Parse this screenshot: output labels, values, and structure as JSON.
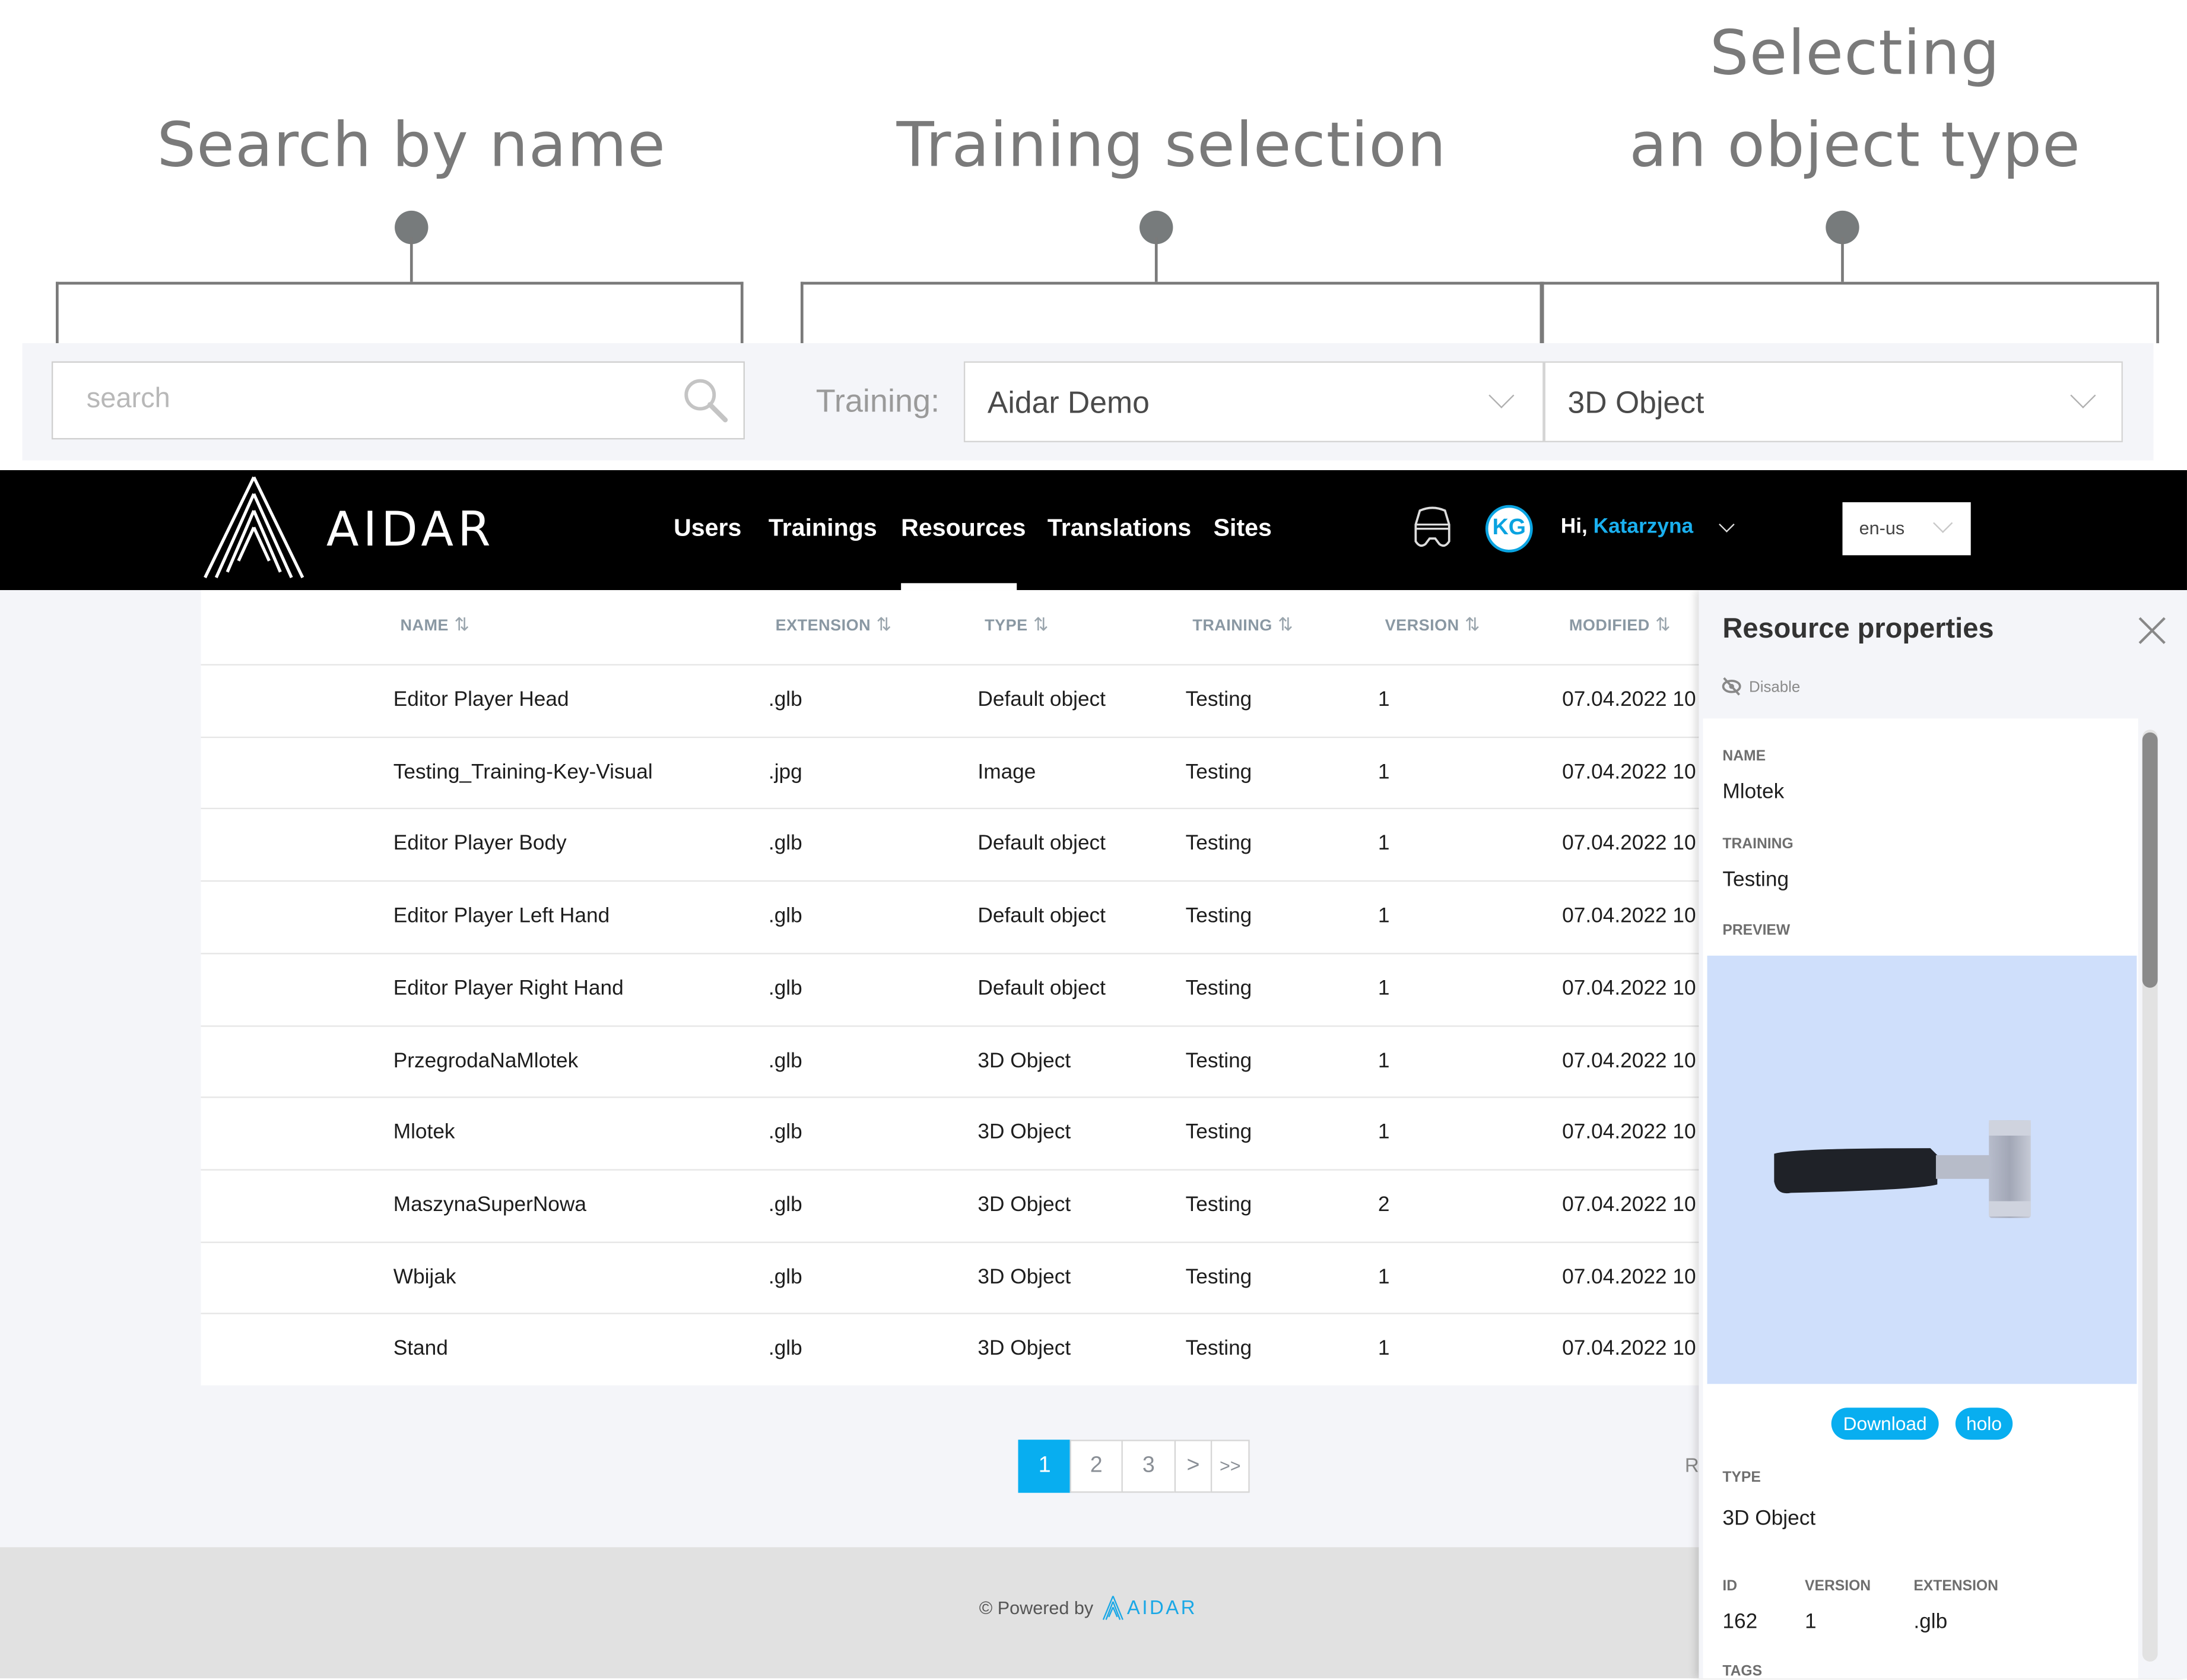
{
  "annotations": {
    "search": "Search by name",
    "training": "Training selection",
    "object_type_line1": "Selecting",
    "object_type_line2": "an object type"
  },
  "filters": {
    "search_placeholder": "search",
    "search_value": "",
    "training_label": "Training:",
    "training_selected": "Aidar Demo",
    "type_selected": "3D Object"
  },
  "navbar": {
    "brand": "AIDAR",
    "links": [
      "Users",
      "Trainings",
      "Resources",
      "Translations",
      "Sites"
    ],
    "active": "Resources",
    "avatar_initials": "KG",
    "greeting": "Hi,",
    "username": "Katarzyna",
    "language": "en-us",
    "icons": {
      "headset": "vr-headset-icon"
    }
  },
  "table": {
    "columns": [
      "NAME",
      "EXTENSION",
      "TYPE",
      "TRAINING",
      "VERSION",
      "MODIFIED"
    ],
    "sort_glyph": "⇅",
    "rows": [
      {
        "name": "Editor Player Head",
        "extension": ".glb",
        "type": "Default object",
        "training": "Testing",
        "version": "1",
        "modified": "07.04.2022 10"
      },
      {
        "name": "Testing_Training-Key-Visual",
        "extension": ".jpg",
        "type": "Image",
        "training": "Testing",
        "version": "1",
        "modified": "07.04.2022 10"
      },
      {
        "name": "Editor Player Body",
        "extension": ".glb",
        "type": "Default object",
        "training": "Testing",
        "version": "1",
        "modified": "07.04.2022 10"
      },
      {
        "name": "Editor Player Left Hand",
        "extension": ".glb",
        "type": "Default object",
        "training": "Testing",
        "version": "1",
        "modified": "07.04.2022 10"
      },
      {
        "name": "Editor Player Right Hand",
        "extension": ".glb",
        "type": "Default object",
        "training": "Testing",
        "version": "1",
        "modified": "07.04.2022 10"
      },
      {
        "name": "PrzegrodaNaMlotek",
        "extension": ".glb",
        "type": "3D Object",
        "training": "Testing",
        "version": "1",
        "modified": "07.04.2022 10"
      },
      {
        "name": "Mlotek",
        "extension": ".glb",
        "type": "3D Object",
        "training": "Testing",
        "version": "1",
        "modified": "07.04.2022 10"
      },
      {
        "name": "MaszynaSuperNowa",
        "extension": ".glb",
        "type": "3D Object",
        "training": "Testing",
        "version": "2",
        "modified": "07.04.2022 10"
      },
      {
        "name": "Wbijak",
        "extension": ".glb",
        "type": "3D Object",
        "training": "Testing",
        "version": "1",
        "modified": "07.04.2022 10"
      },
      {
        "name": "Stand",
        "extension": ".glb",
        "type": "3D Object",
        "training": "Testing",
        "version": "1",
        "modified": "07.04.2022 10"
      }
    ]
  },
  "pagination": {
    "pages": [
      "1",
      "2",
      "3",
      ">",
      ">>"
    ],
    "current": "1",
    "truncated_text": "R"
  },
  "footer": {
    "powered_by": "© Powered by",
    "brand": "AIDAR"
  },
  "panel": {
    "title": "Resource properties",
    "disable_label": "Disable",
    "name_label": "NAME",
    "name_value": "Mlotek",
    "training_label": "TRAINING",
    "training_value": "Testing",
    "preview_label": "PREVIEW",
    "download_label": "Download",
    "holo_label": "holo",
    "type_label": "TYPE",
    "type_value": "3D Object",
    "id_label": "ID",
    "id_value": "162",
    "version_label": "VERSION",
    "version_value": "1",
    "extension_label": "EXTENSION",
    "extension_value": ".glb",
    "tags_label": "TAGS"
  },
  "colors": {
    "accent": "#08aef0",
    "navbar": "#000000",
    "preview_bg": "#cfdffb"
  }
}
